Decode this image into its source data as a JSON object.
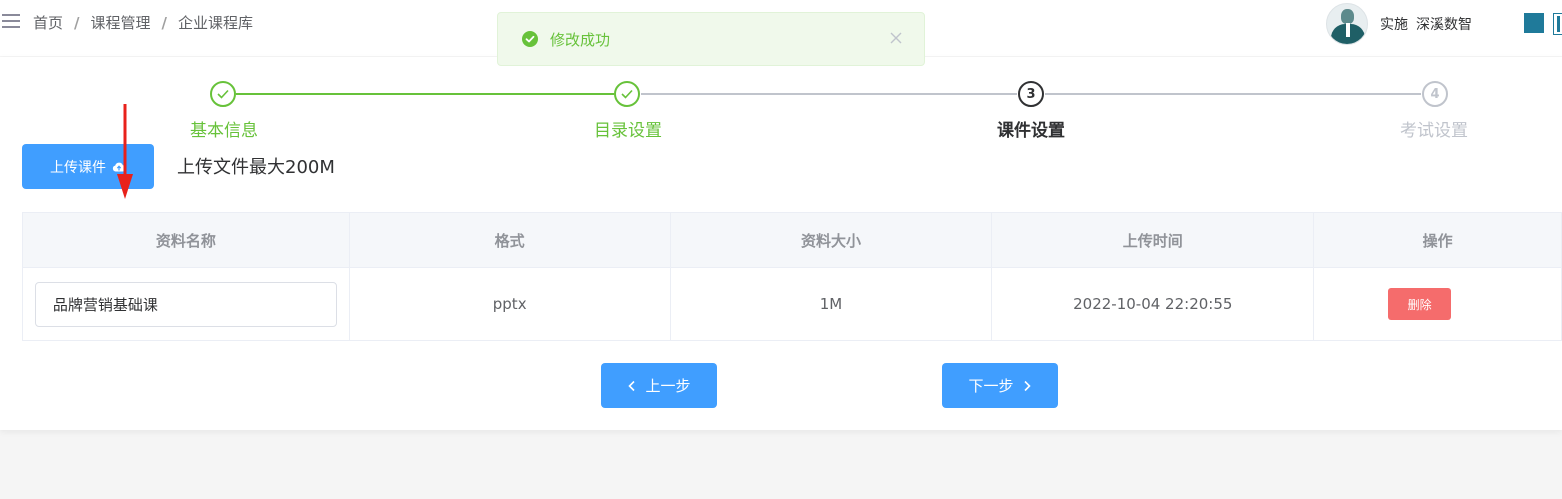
{
  "breadcrumb": [
    "首页",
    "课程管理",
    "企业课程库"
  ],
  "user": {
    "name": "实施",
    "org": "深溪数智"
  },
  "toast": {
    "message": "修改成功"
  },
  "steps": [
    {
      "label": "基本信息",
      "number": "1",
      "status": "done"
    },
    {
      "label": "目录设置",
      "number": "2",
      "status": "done"
    },
    {
      "label": "课件设置",
      "number": "3",
      "status": "active"
    },
    {
      "label": "考试设置",
      "number": "4",
      "status": "pending"
    }
  ],
  "upload": {
    "button_label": "上传课件",
    "hint": "上传文件最大200M"
  },
  "table": {
    "headers": [
      "资料名称",
      "格式",
      "资料大小",
      "上传时间",
      "操作"
    ],
    "rows": [
      {
        "name": "品牌营销基础课",
        "format": "pptx",
        "size": "1M",
        "time": "2022-10-04 22:20:55",
        "action": "删除"
      }
    ]
  },
  "nav": {
    "prev": "上一步",
    "next": "下一步"
  },
  "colors": {
    "primary": "#409eff",
    "success": "#67c23a",
    "danger": "#f56c6c",
    "annotation_arrow": "#e8211b"
  },
  "icons": [
    "menu-icon",
    "check-circle-icon",
    "close-icon",
    "cloud-upload-icon",
    "chevron-left-icon",
    "chevron-right-icon",
    "avatar"
  ]
}
